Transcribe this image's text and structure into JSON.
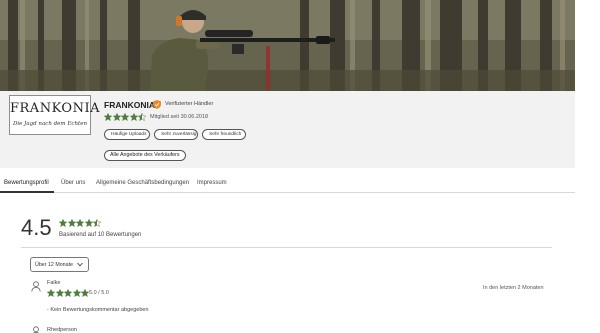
{
  "seller": {
    "logo_name": "FRANKONIA",
    "logo_tagline": "Die Jagd nach dem Echten",
    "name": "FRANKONIA",
    "verified_label": "Verifizierter Händler",
    "member_since": "Mitglied seit 30.06.2018",
    "rating_stars": 4.5,
    "badges": [
      {
        "label": "Häufige Uploads",
        "icon": "upload-icon"
      },
      {
        "label": "Sehr zuverlässig",
        "icon": "thumbs-up-icon"
      },
      {
        "label": "Sehr freundlich",
        "icon": "smile-icon"
      }
    ],
    "all_offers_label": "Alle Angebote des Verkäufers"
  },
  "tabs": [
    {
      "label": "Bewertungsprofil",
      "active": true
    },
    {
      "label": "Über uns",
      "active": false
    },
    {
      "label": "Allgemeine Geschäftsbedingungen",
      "active": false
    },
    {
      "label": "Impressum",
      "active": false
    }
  ],
  "summary": {
    "score": "4.5",
    "stars": 4.5,
    "based_on": "Basierend auf 10 Bewertungen"
  },
  "filter": {
    "period": "Über 12 Monate"
  },
  "reviews": [
    {
      "reviewer": "Falke",
      "stars": 5,
      "score": "5.0 / 5.0",
      "time": "In den letzten 2 Monaten",
      "comment": "- Kein Bewertungskommentar abgegeben"
    },
    {
      "reviewer": "Rhedperson"
    }
  ],
  "colors": {
    "star": "#4e7d3c",
    "verified": "#e8892b",
    "band": "#f2f2f2"
  }
}
